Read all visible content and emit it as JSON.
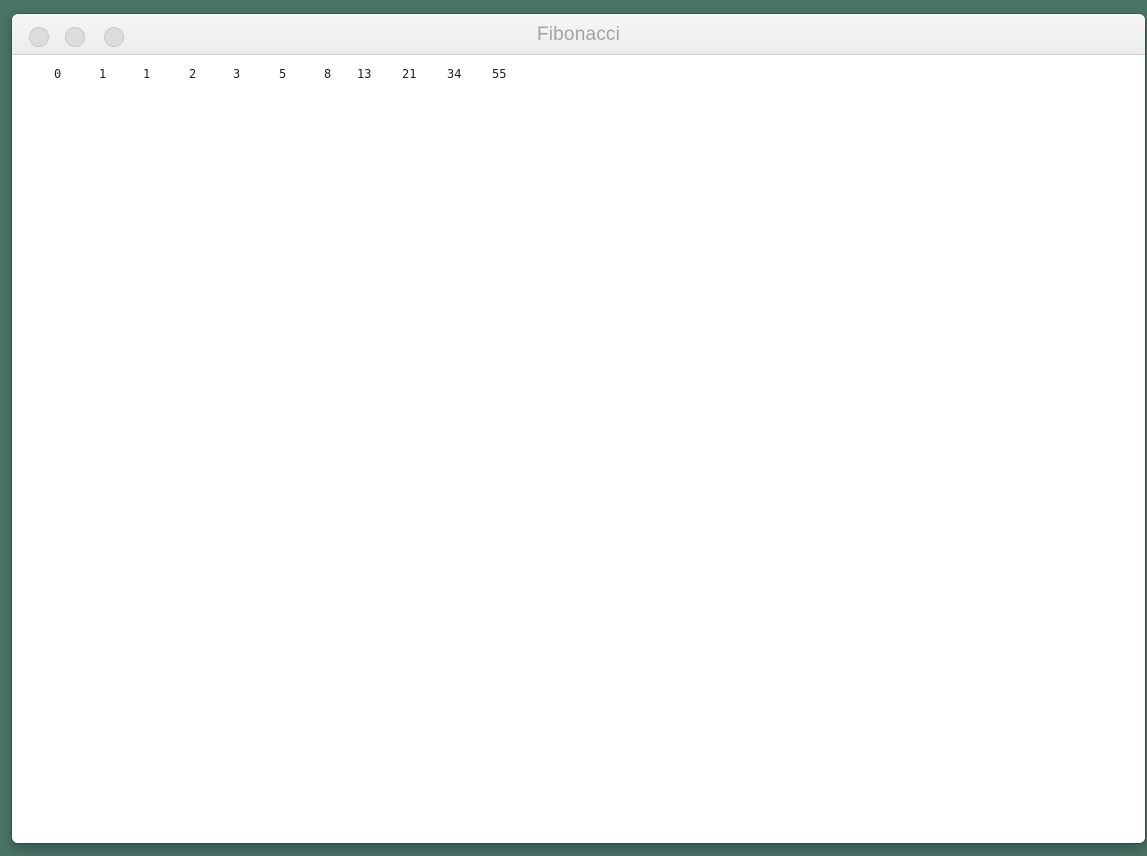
{
  "window": {
    "title": "Fibonacci"
  },
  "content": {
    "values": [
      "0",
      "1",
      "1",
      "2",
      "3",
      "5",
      "8",
      "13",
      "21",
      "34",
      "55"
    ]
  }
}
